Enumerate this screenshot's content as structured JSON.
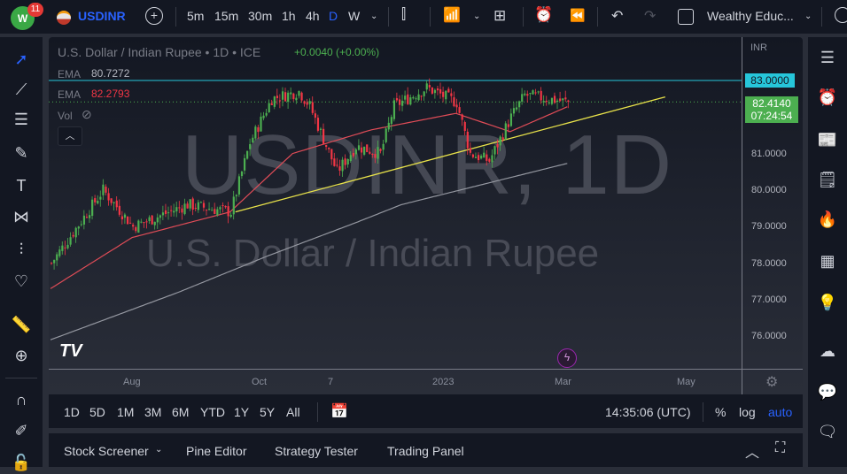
{
  "topbar": {
    "notifications": "11",
    "symbol": "USDINR",
    "intervals": [
      "5m",
      "15m",
      "30m",
      "1h",
      "4h",
      "D",
      "W"
    ],
    "active_interval": "D",
    "layout_name": "Wealthy Educ..."
  },
  "legend": {
    "title": "U.S. Dollar / Indian Rupee • 1D • ICE",
    "change": "+0.0040 (+0.00%)",
    "ema1_label": "EMA",
    "ema1_value": "80.7272",
    "ema2_label": "EMA",
    "ema2_value": "82.2793",
    "vol_label": "Vol"
  },
  "watermark": {
    "line1": "USDINR, 1D",
    "line2": "U.S. Dollar / Indian Rupee"
  },
  "price_axis": {
    "currency": "INR",
    "ticks": [
      "81.0000",
      "80.0000",
      "79.0000",
      "78.0000",
      "77.0000",
      "76.0000"
    ],
    "hline_label": "83.0000",
    "last_price": "82.4140",
    "countdown": "07:24:54"
  },
  "time_axis": {
    "labels": [
      "Aug",
      "Oct",
      "7",
      "2023",
      "Mar",
      "May"
    ]
  },
  "bottombar": {
    "ranges": [
      "1D",
      "5D",
      "1M",
      "3M",
      "6M",
      "YTD",
      "1Y",
      "5Y",
      "All"
    ],
    "clock": "14:35:06 (UTC)",
    "percent": "%",
    "log": "log",
    "auto": "auto"
  },
  "panel": {
    "tabs": [
      "Stock Screener",
      "Pine Editor",
      "Strategy Tester",
      "Trading Panel"
    ]
  },
  "colors": {
    "up": "#26a69a",
    "green": "#4caf50",
    "down": "#f23645",
    "accent": "#2962ff",
    "hline": "#26c6da",
    "trend": "#e8e24a",
    "ema_fast": "#e04c57",
    "ema_slow": "#9598a1"
  },
  "chart_data": {
    "type": "candlestick",
    "price_range": [
      75.6,
      83.8
    ],
    "hline": 83.0,
    "last": 82.414,
    "close_keypoints": [
      [
        0,
        78.0
      ],
      [
        19,
        80.0
      ],
      [
        30,
        79.0
      ],
      [
        50,
        79.6
      ],
      [
        66,
        79.4
      ],
      [
        73,
        81.3
      ],
      [
        81,
        82.5
      ],
      [
        91,
        82.7
      ],
      [
        95,
        82.3
      ],
      [
        105,
        80.5
      ],
      [
        112,
        81.2
      ],
      [
        121,
        81.0
      ],
      [
        126,
        82.3
      ],
      [
        138,
        82.8
      ],
      [
        149,
        82.4
      ],
      [
        154,
        81.0
      ],
      [
        161,
        80.8
      ],
      [
        169,
        82.0
      ],
      [
        174,
        82.6
      ],
      [
        190,
        82.41
      ]
    ],
    "ema_fast": [
      [
        0,
        77.3
      ],
      [
        30,
        78.7
      ],
      [
        66,
        79.4
      ],
      [
        89,
        81.0
      ],
      [
        118,
        81.65
      ],
      [
        149,
        82.1
      ],
      [
        169,
        81.6
      ],
      [
        190,
        82.28
      ]
    ],
    "ema_slow": [
      [
        0,
        75.9
      ],
      [
        47,
        77.2
      ],
      [
        80,
        78.2
      ],
      [
        112,
        79.1
      ],
      [
        129,
        79.6
      ],
      [
        190,
        80.73
      ]
    ],
    "trendline": [
      [
        68,
        79.4
      ],
      [
        226,
        82.55
      ]
    ]
  }
}
